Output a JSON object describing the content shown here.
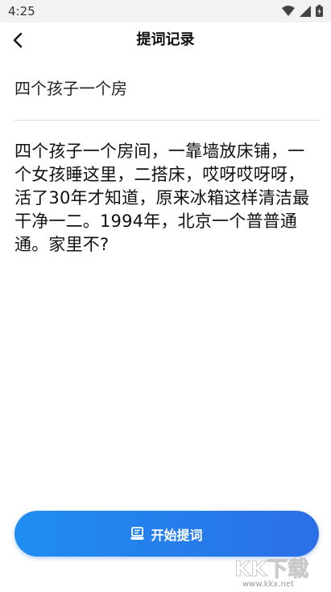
{
  "status_bar": {
    "time": "4:25"
  },
  "header": {
    "title": "提词记录"
  },
  "record": {
    "title": "四个孩子一个房",
    "content": "四个孩子一个房间，一靠墙放床铺，一个女孩睡这里，二搭床，哎呀哎呀呀，活了30年才知道，原来冰箱这样清洁最干净一二。1994年，北京一个普普通通。家里不?"
  },
  "start_button": {
    "label": "开始提词"
  },
  "watermark": {
    "brand": "KK下载",
    "url": "www.kkx.net"
  },
  "colors": {
    "accent": "#2b7fe9",
    "divider": "#dcdcdc"
  }
}
